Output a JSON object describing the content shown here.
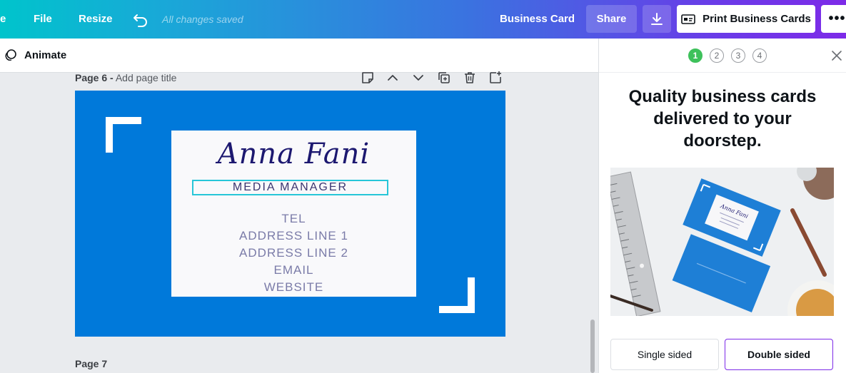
{
  "topbar": {
    "home_fragment": "e",
    "file": "File",
    "resize": "Resize",
    "saved_status": "All changes saved",
    "doc_name": "Business Card",
    "share": "Share",
    "print": "Print Business Cards",
    "more": "•••"
  },
  "subbar": {
    "animate": "Animate"
  },
  "pages": {
    "page6_number": "Page 6 -",
    "page6_placeholder": "Add page title",
    "page7": "Page 7"
  },
  "card": {
    "name": "Anna Fani",
    "title": "MEDIA MANAGER",
    "contact": [
      "TEL",
      "ADDRESS LINE 1",
      "ADDRESS LINE 2",
      "EMAIL",
      "WEBSITE"
    ]
  },
  "photo_card": {
    "name": "Anna Fani"
  },
  "panel": {
    "steps": [
      "1",
      "2",
      "3",
      "4"
    ],
    "active_step": 1,
    "headline": "Quality business cards delivered to your doorstep.",
    "single_sided": "Single sided",
    "double_sided": "Double sided"
  },
  "colors": {
    "card_blue": "#0079da",
    "accent_purple": "#7d2ae8",
    "step_active": "#3ec15b",
    "title_box": "#27c6d8"
  }
}
